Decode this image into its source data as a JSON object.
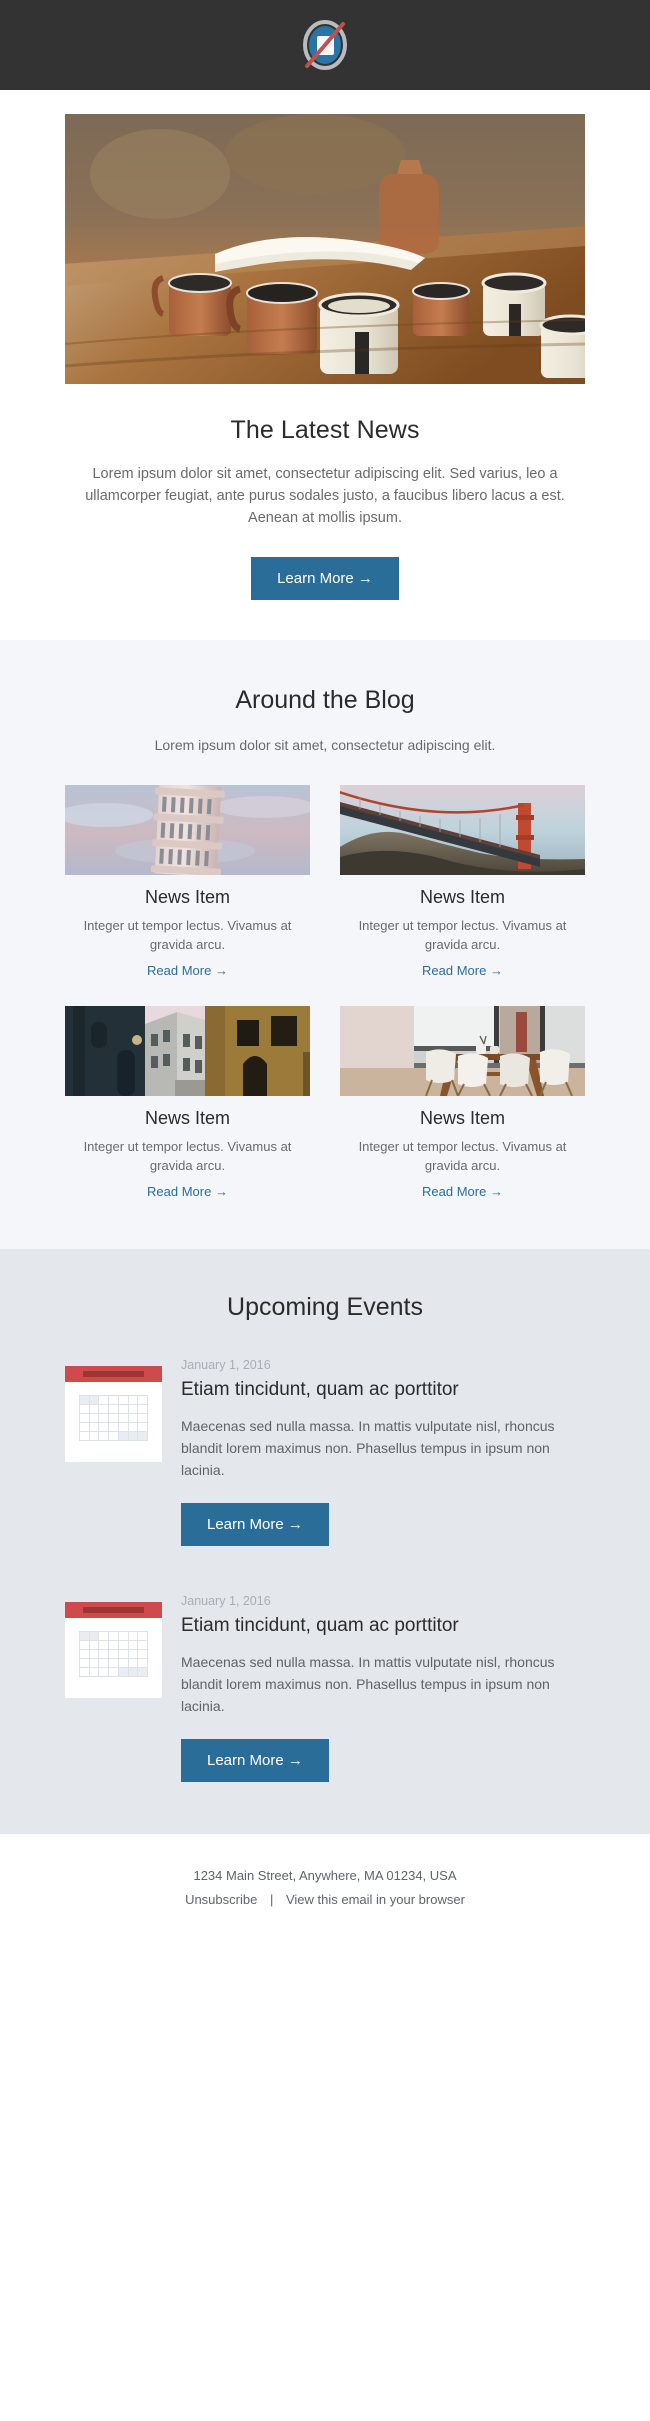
{
  "header": {
    "logo_icon": "broken-image-icon",
    "background": "#333333"
  },
  "hero": {
    "image_alt": "enamel mugs on a wooden table",
    "title": "The Latest News",
    "body": "Lorem ipsum dolor sit amet, consectetur adipiscing elit. Sed varius, leo a ullamcorper feugiat, ante purus sodales justo, a faucibus libero lacus a est. Aenean at mollis ipsum.",
    "button_label": "Learn More →"
  },
  "blog": {
    "title": "Around the Blog",
    "subtitle": "Lorem ipsum dolor sit amet, consectetur adipiscing elit.",
    "cards": [
      {
        "image_alt": "leaning tower of pisa",
        "title": "News Item",
        "body": "Integer ut tempor lectus. Vivamus at gravida arcu.",
        "link_label": "Read More →"
      },
      {
        "image_alt": "golden gate bridge",
        "title": "News Item",
        "body": "Integer ut tempor lectus. Vivamus at gravida arcu.",
        "link_label": "Read More →"
      },
      {
        "image_alt": "narrow european street",
        "title": "News Item",
        "body": "Integer ut tempor lectus. Vivamus at gravida arcu.",
        "link_label": "Read More →"
      },
      {
        "image_alt": "dining room with white chairs",
        "title": "News Item",
        "body": "Integer ut tempor lectus. Vivamus at gravida arcu.",
        "link_label": "Read More →"
      }
    ]
  },
  "events": {
    "title": "Upcoming Events",
    "items": [
      {
        "icon": "calendar-icon",
        "date": "January 1, 2016",
        "title": "Etiam tincidunt, quam ac porttitor",
        "body": "Maecenas sed nulla massa. In mattis vulputate nisl, rhoncus blandit lorem maximus non. Phasellus tempus in ipsum non lacinia.",
        "button_label": "Learn More →"
      },
      {
        "icon": "calendar-icon",
        "date": "January 1, 2016",
        "title": "Etiam tincidunt, quam ac porttitor",
        "body": "Maecenas sed nulla massa. In mattis vulputate nisl, rhoncus blandit lorem maximus non. Phasellus tempus in ipsum non lacinia.",
        "button_label": "Learn More →"
      }
    ]
  },
  "footer": {
    "address": "1234 Main Street, Anywhere, MA 01234, USA",
    "unsubscribe_label": "Unsubscribe",
    "separator": "|",
    "view_in_browser_label": "View this email in your browser"
  },
  "colors": {
    "accent": "#2b6d99",
    "header_bg": "#333333",
    "blog_bg": "#f4f6f9",
    "events_bg": "#e4e8ed",
    "calendar_red": "#cf4b4b"
  }
}
